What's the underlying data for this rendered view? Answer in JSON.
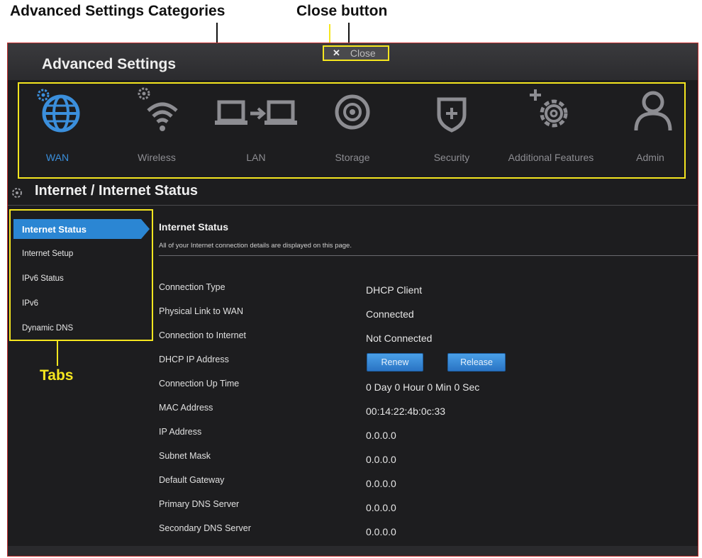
{
  "annotations": {
    "categories_label": "Advanced Settings Categories",
    "close_label": "Close button",
    "tabs_label": "Tabs"
  },
  "header": {
    "title": "Advanced Settings",
    "close_label": "Close"
  },
  "categories": [
    {
      "label": "WAN",
      "icon": "globe-icon",
      "active": true
    },
    {
      "label": "Wireless",
      "icon": "wifi-icon",
      "active": false
    },
    {
      "label": "LAN",
      "icon": "lan-icon",
      "active": false
    },
    {
      "label": "Storage",
      "icon": "storage-icon",
      "active": false
    },
    {
      "label": "Security",
      "icon": "shield-icon",
      "active": false
    },
    {
      "label": "Additional Features",
      "icon": "gear-plus-icon",
      "active": false
    },
    {
      "label": "Admin",
      "icon": "user-icon",
      "active": false
    }
  ],
  "breadcrumb": "Internet / Internet Status",
  "tabs": [
    {
      "label": "Internet Status",
      "active": true
    },
    {
      "label": "Internet Setup",
      "active": false
    },
    {
      "label": "IPv6 Status",
      "active": false
    },
    {
      "label": "IPv6",
      "active": false
    },
    {
      "label": "Dynamic DNS",
      "active": false
    }
  ],
  "panel": {
    "title": "Internet Status",
    "description": "All of your Internet connection details are displayed on this page."
  },
  "rows": [
    {
      "label": "Connection Type",
      "value": "DHCP Client"
    },
    {
      "label": "Physical Link to WAN",
      "value": "Connected"
    },
    {
      "label": "Connection to Internet",
      "value": "Not Connected"
    },
    {
      "label": "DHCP IP Address",
      "value": ""
    },
    {
      "label": "Connection Up Time",
      "value": "0 Day 0 Hour 0 Min 0 Sec"
    },
    {
      "label": "MAC Address",
      "value": "00:14:22:4b:0c:33"
    },
    {
      "label": "IP Address",
      "value": "0.0.0.0"
    },
    {
      "label": "Subnet Mask",
      "value": "0.0.0.0"
    },
    {
      "label": "Default Gateway",
      "value": "0.0.0.0"
    },
    {
      "label": "Primary DNS Server",
      "value": "0.0.0.0"
    },
    {
      "label": "Secondary DNS Server",
      "value": "0.0.0.0"
    }
  ],
  "buttons": {
    "renew": "Renew",
    "release": "Release"
  },
  "colors": {
    "accent": "#2b86d3",
    "highlight": "#f5e61f",
    "background": "#1d1d1f"
  }
}
